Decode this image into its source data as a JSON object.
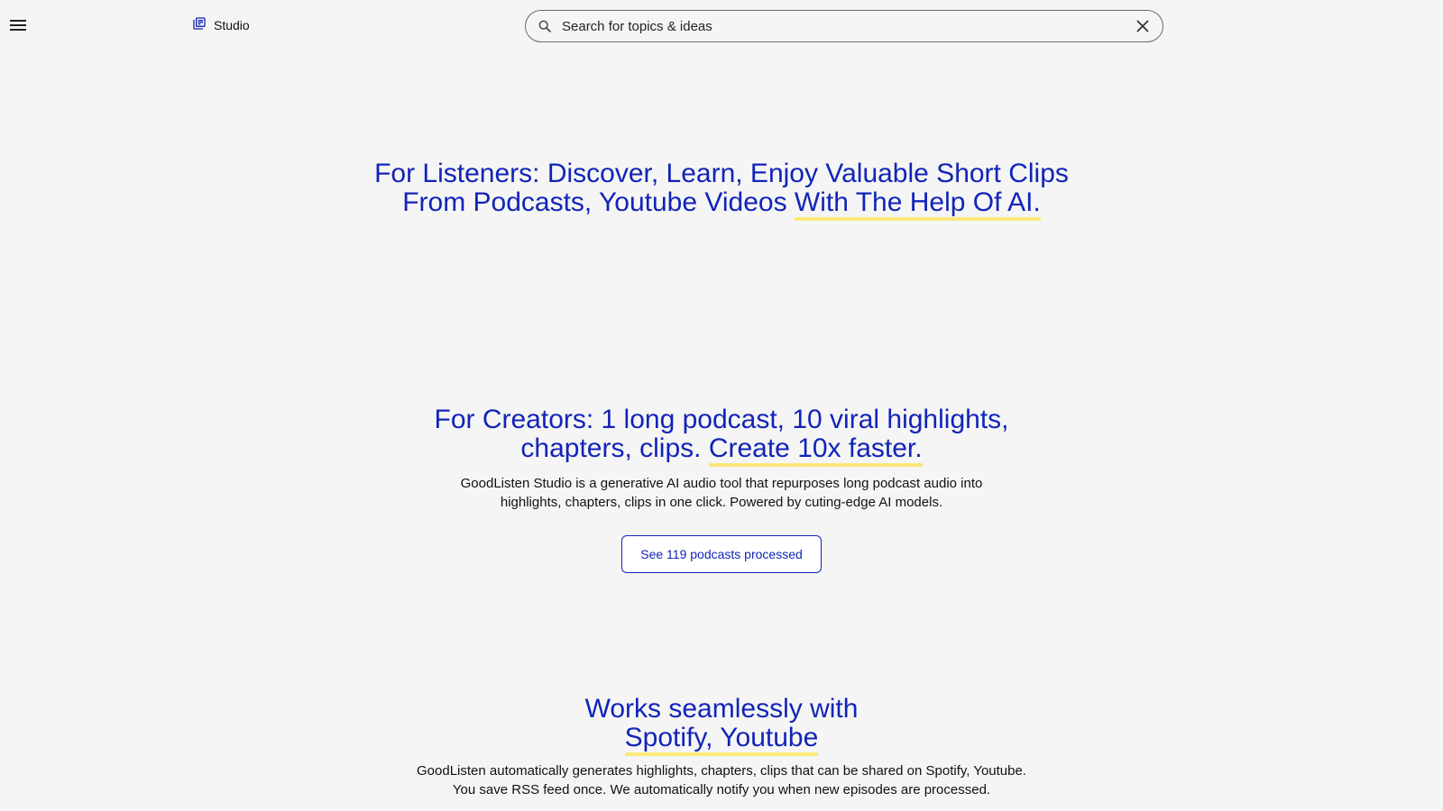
{
  "header": {
    "menu_icon": "hamburger-menu-icon",
    "studio_icon": "library-books-icon",
    "studio_label": "Studio",
    "search_placeholder": "Search for topics & ideas",
    "search_icon": "search-icon",
    "clear_icon": "close-icon"
  },
  "listeners": {
    "title_line1": "For Listeners: Discover, Learn, Enjoy Valuable Short Clips",
    "title_line2_plain": "From Podcasts, Youtube Videos ",
    "title_line2_highlight": "With The Help Of AI."
  },
  "creators": {
    "title_line1": "For Creators: 1 long podcast, 10 viral highlights,",
    "title_line2_plain": "chapters, clips. ",
    "title_line2_highlight": "Create 10x faster.",
    "desc_line1": "GoodListen Studio is a generative AI audio tool that repurposes long podcast audio into",
    "desc_line2": "highlights, chapters, clips in one click. Powered by cuting-edge AI models.",
    "cta_label": "See 119 podcasts processed"
  },
  "integrations": {
    "title_line1": "Works seamlessly with",
    "title_line2_highlight": "Spotify, Youtube",
    "desc_line1": "GoodListen automatically generates highlights, chapters, clips that can be shared on Spotify, Youtube.",
    "desc_line2": "You save RSS feed once. We automatically notify you when new episodes are processed."
  },
  "colors": {
    "accent": "#1224b8",
    "highlight": "#fce87a",
    "background": "#f5f5f5"
  }
}
